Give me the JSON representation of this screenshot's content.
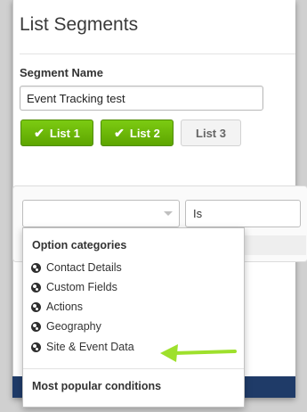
{
  "page": {
    "title": "List Segments"
  },
  "segment": {
    "name_label": "Segment Name",
    "name_value": "Event Tracking test"
  },
  "lists": [
    {
      "label": "List 1",
      "selected": true
    },
    {
      "label": "List 2",
      "selected": true
    },
    {
      "label": "List 3",
      "selected": false
    }
  ],
  "condition": {
    "category_value": "",
    "operator_value": "Is"
  },
  "dropdown": {
    "section_title": "Option categories",
    "items": [
      {
        "label": "Contact Details",
        "icon": "globe-icon"
      },
      {
        "label": "Custom Fields",
        "icon": "globe-icon"
      },
      {
        "label": "Actions",
        "icon": "globe-icon"
      },
      {
        "label": "Geography",
        "icon": "globe-icon"
      },
      {
        "label": "Site & Event Data",
        "icon": "globe-icon",
        "highlighted": true
      }
    ],
    "popular_title": "Most popular conditions"
  },
  "colors": {
    "accent_green": "#6cbc0a",
    "annotation_arrow": "#9ee02c",
    "footer_navy": "#1f3b68"
  }
}
